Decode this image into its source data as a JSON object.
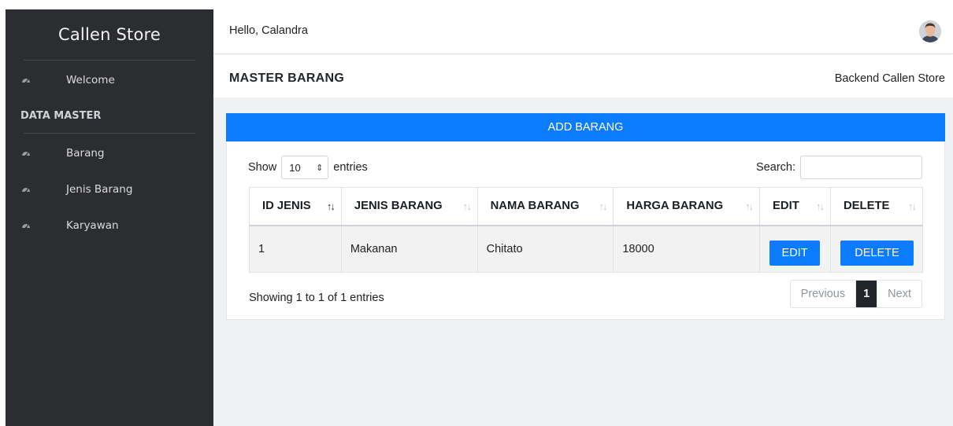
{
  "sidebar": {
    "brand": "Callen Store",
    "welcome_label": "Welcome",
    "section_label": "DATA MASTER",
    "items": [
      {
        "label": "Barang",
        "icon": "dashboard-icon"
      },
      {
        "label": "Jenis Barang",
        "icon": "dashboard-icon"
      },
      {
        "label": "Karyawan",
        "icon": "dashboard-icon"
      }
    ]
  },
  "header": {
    "greeting": "Hello, Calandra",
    "avatar": "user-avatar"
  },
  "page": {
    "title": "MASTER BARANG",
    "breadcrumb": "Backend Callen Store"
  },
  "card": {
    "add_button": "ADD BARANG",
    "show_label": "Show",
    "entries_value": "10",
    "entries_label": "entries",
    "search_label": "Search:",
    "search_value": ""
  },
  "table": {
    "columns": [
      "ID JENIS",
      "JENIS BARANG",
      "NAMA BARANG",
      "HARGA BARANG",
      "EDIT",
      "DELETE"
    ],
    "sorted_column": "ID JENIS",
    "rows": [
      {
        "id": "1",
        "jenis": "Makanan",
        "nama": "Chitato",
        "harga": "18000",
        "edit": "EDIT",
        "delete": "DELETE"
      }
    ]
  },
  "footer": {
    "info": "Showing 1 to 1 of 1 entries",
    "previous": "Previous",
    "page": "1",
    "next": "Next"
  },
  "colors": {
    "sidebar_bg": "#2b2d30",
    "accent": "#0b7cff",
    "content_bg": "#f0f1f3"
  }
}
